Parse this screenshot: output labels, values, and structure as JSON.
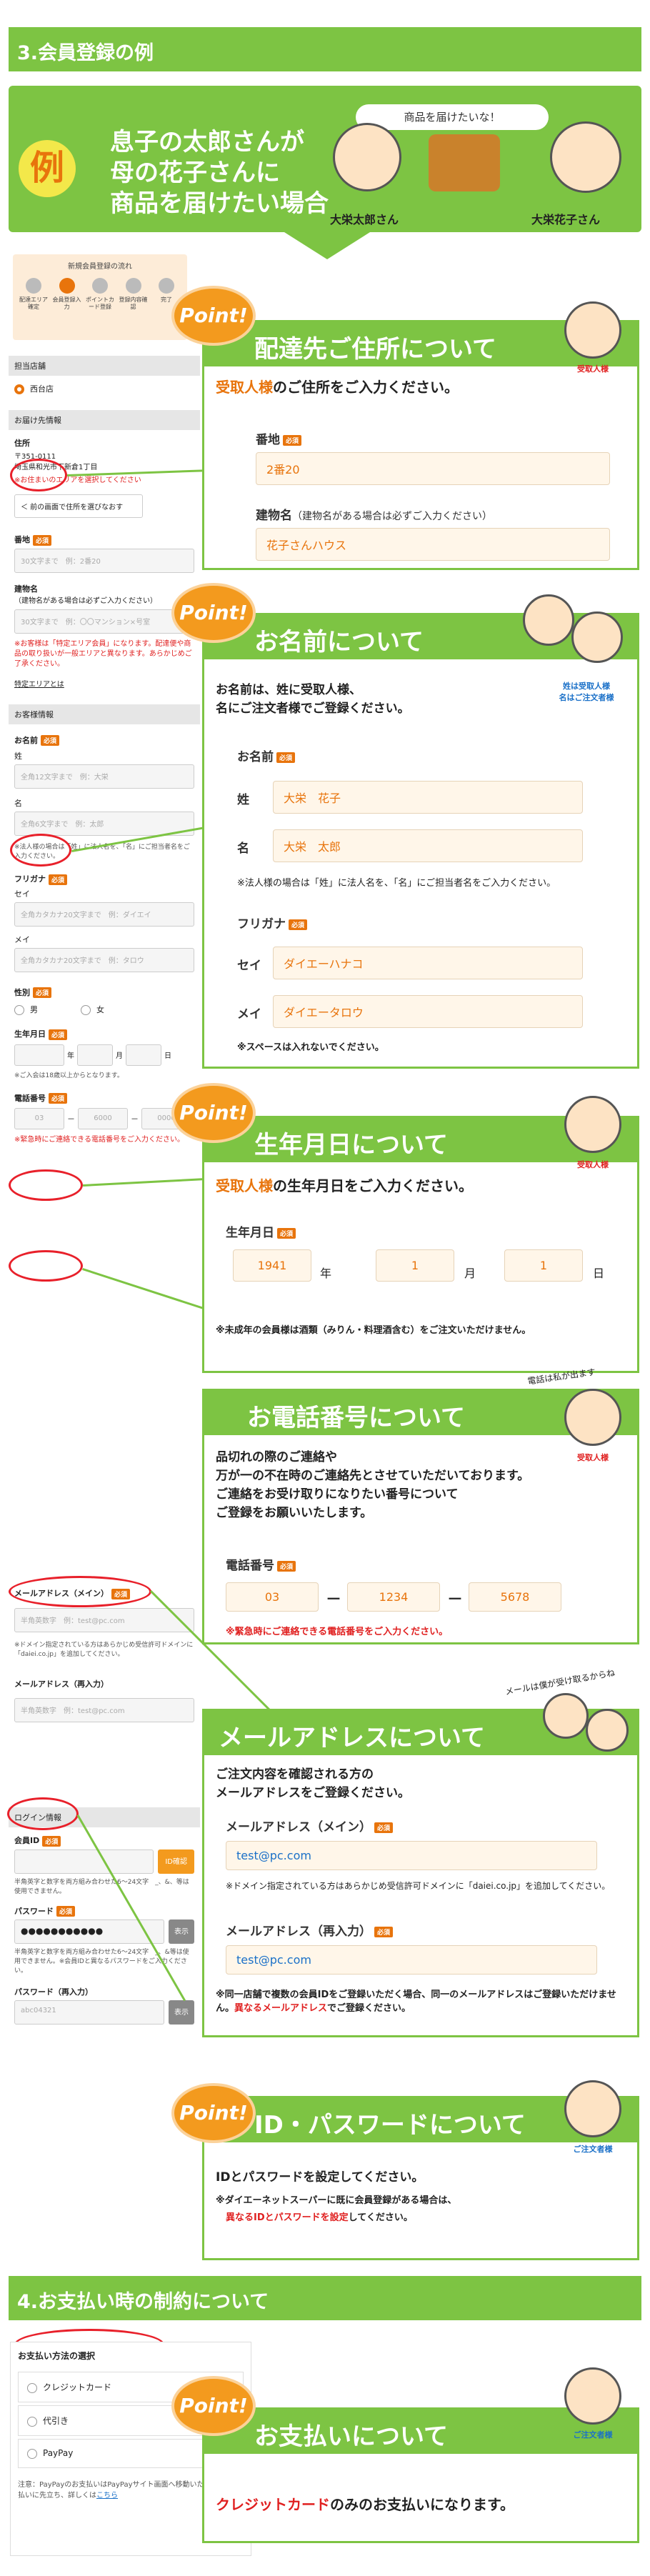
{
  "section1": {
    "title": "3.会員登録の例"
  },
  "hero": {
    "rei": "例",
    "lines": [
      "息子の太郎さんが",
      "母の花子さんに",
      "商品を届けたい場合"
    ],
    "bubble": "商品を届けたいな！",
    "son_name": "大栄太郎さん",
    "mother_name": "大栄花子さん"
  },
  "flow": {
    "title": "新規会員登録の流れ",
    "steps": [
      "配達エリア確定",
      "会員登録入力",
      "ポイントカード登録",
      "登録内容確認",
      "完了"
    ]
  },
  "point_label": "Point!",
  "left_form": {
    "store_bar": "担当店舗",
    "store_value": "西台店",
    "addr_bar": "お届け先情報",
    "addr_label": "住所",
    "zip": "〒351-0111",
    "addr_line": "埼玉県和光市下新倉1丁目",
    "addr_red": "※お住まいのエリアを選択してください",
    "back_btn": "＜ 前の画面で住所を選びなおす",
    "banchi_label": "番地",
    "banchi_ph": "30文字まで　例：2番20",
    "building_label": "建物名",
    "building_sub": "（建物名がある場合は必ずご入力ください）",
    "building_ph": "30文字まで　例：〇〇マンション×号室",
    "building_red": "※お客様は「特定エリア会員」になります。配達便や商品の取り扱いが一般エリアと異なります。あらかじめご了承ください。",
    "tokutei_link": "特定エリアとは",
    "cust_bar": "お客様情報",
    "name_label": "お名前",
    "sei_label": "姓",
    "sei_ph": "全角12文字まで　例：大栄",
    "mei_label": "名",
    "mei_ph": "全角6文字まで　例：太郎",
    "name_note": "※法人様の場合は「姓」に法人名を、「名」にご担当者名をご入力ください。",
    "furi_label": "フリガナ",
    "furi_sei_label": "セイ",
    "furi_sei_ph": "全角カタカナ20文字まで　例：ダイエイ",
    "furi_mei_label": "メイ",
    "furi_mei_ph": "全角カタカナ20文字まで　例：タロウ",
    "gender_label": "性別",
    "gender_m": "男",
    "gender_f": "女",
    "birth_label": "生年月日",
    "birth_unit_y": "年",
    "birth_unit_m": "月",
    "birth_unit_d": "日",
    "birth_note": "※ご入会は18歳以上からとなります。",
    "tel_label": "電話番号",
    "tel_ph1": "03",
    "tel_ph2": "6000",
    "tel_ph3": "0000",
    "tel_red": "※緊急時にご連絡できる電話番号をご入力ください。",
    "mail_label": "メールアドレス（メイン）",
    "mail_ph": "半角英数字　例：test@pc.com",
    "mail_note": "※ドメイン指定されている方はあらかじめ受信許可ドメインに「daiei.co.jp」を追加してください。",
    "mail2_label": "メールアドレス（再入力）",
    "mail2_ph": "半角英数字　例：test@pc.com",
    "login_bar": "ログイン情報",
    "id_label": "会員ID",
    "id_btn": "ID確認",
    "id_note": "半角英字と数字を両方組み合わせた6〜24文字　_、&、等は使用できません。",
    "pw_label": "パスワード",
    "pw_value": "●●●●●●●●●●●",
    "pw_show": "表示",
    "pw_note": "半角英字と数字を両方組み合わせた6〜24文字　_、&等は使用できません。※会員IDと異なるパスワードをご入力ください。",
    "pw2_label": "パスワード（再入力）",
    "pw2_ph": "abc04321",
    "pw2_show": "表示"
  },
  "box_address": {
    "title": "配達先ご住所について",
    "badge": "受取人様",
    "intro_highlight": "受取人様",
    "intro_rest": "のご住所をご入力ください。",
    "banchi_label": "番地",
    "banchi_value": "2番20",
    "building_label": "建物名",
    "building_sub": "（建物名がある場合は必ずご入力ください）",
    "building_value": "花子さんハウス"
  },
  "box_name": {
    "title": "お名前について",
    "badge1": "姓は受取人様",
    "badge2": "名はご注文者様",
    "intro1": "お名前は、姓に受取人様、",
    "intro2": "名にご注文者様でご登録ください。",
    "label": "お名前",
    "sei_label": "姓",
    "sei_value": "大栄　花子",
    "mei_label": "名",
    "mei_value": "大栄　太郎",
    "note": "※法人様の場合は「姓」に法人名を、「名」にご担当者名をご入力ください。",
    "furi_label": "フリガナ",
    "furi_sei_label": "セイ",
    "furi_sei_value": "ダイエーハナコ",
    "furi_mei_label": "メイ",
    "furi_mei_value": "ダイエータロウ",
    "space_note": "※スペースは入れないでください。"
  },
  "box_birth": {
    "title": "生年月日について",
    "badge": "受取人様",
    "intro_highlight": "受取人様",
    "intro_rest": "の生年月日をご入力ください。",
    "label": "生年月日",
    "year": "1941",
    "month": "1",
    "day": "1",
    "unit_y": "年",
    "unit_m": "月",
    "unit_d": "日",
    "note": "※未成年の会員様は酒類（みりん・料理酒含む）をご注文いただけません。"
  },
  "box_tel": {
    "title": "お電話番号について",
    "bubble": "電話は私が出ます",
    "badge": "受取人様",
    "body": [
      "品切れの際のご連絡や",
      "万が一の不在時のご連絡先とさせていただいております。",
      "ご連絡をお受け取りになりたい番号について",
      "ご登録をお願いいたします。"
    ],
    "label": "電話番号",
    "tel1": "03",
    "tel2": "1234",
    "tel3": "5678",
    "dash": "－",
    "red_note": "※緊急時にご連絡できる電話番号をご入力ください。"
  },
  "box_mail": {
    "title": "メールアドレスについて",
    "bubble": "メールは僕が受け取るからね",
    "intro1": "ご注文内容を確認される方の",
    "intro2": "メールアドレスをご登録ください。",
    "main_label": "メールアドレス（メイン）",
    "main_value": "test@pc.com",
    "domain_note": "※ドメイン指定されている方はあらかじめ受信許可ドメインに「daiei.co.jp」を追加してください。",
    "re_label": "メールアドレス（再入力）",
    "re_value": "test@pc.com",
    "multi_note": "※同一店舗で複数の会員IDをご登録いただく場合、同一のメールアドレスはご登録いただけません。",
    "multi_red": "異なるメールアドレス",
    "multi_rest": "でご登録ください。"
  },
  "box_id": {
    "title": "ID・パスワードについて",
    "badge": "ご注文者様",
    "line1": "IDとパスワードを設定してください。",
    "line2": "※ダイエーネットスーパーに既に会員登録がある場合は、",
    "line3_red": "異なるIDとパスワードを設定",
    "line3_rest": "してください。"
  },
  "section2": {
    "title": "4.お支払い時の制約について"
  },
  "pay_form": {
    "title": "お支払い方法の選択",
    "opt1": "クレジットカード",
    "opt2": "代引き",
    "opt3": "PayPay",
    "note": "注意：PayPayのお支払いはPayPayサイト画面へ移動いたします。支払いに先立ち、詳しくは",
    "link": "こちら"
  },
  "box_pay": {
    "title": "お支払いについて",
    "badge": "ご注文者様",
    "body_red": "クレジットカード",
    "body_rest": "のみのお支払いになります。"
  },
  "colors": {
    "accent": "#7dc443",
    "orange": "#e8740c",
    "red": "#e02020",
    "blue": "#1a70c8"
  }
}
